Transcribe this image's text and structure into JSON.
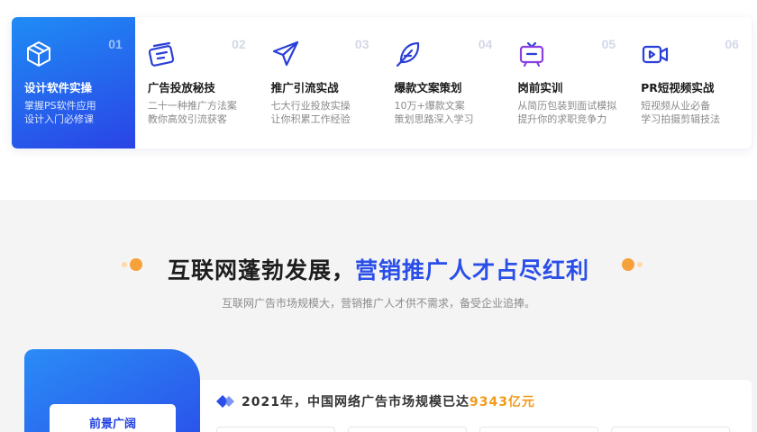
{
  "courses": [
    {
      "num": "01",
      "title": "设计软件实操",
      "desc1": "掌握PS软件应用",
      "desc2": "设计入门必修课",
      "icon": "cube-icon"
    },
    {
      "num": "02",
      "title": "广告投放秘技",
      "desc1": "二十一种推广方法案",
      "desc2": "教你高效引流获客",
      "icon": "card-icon"
    },
    {
      "num": "03",
      "title": "推广引流实战",
      "desc1": "七大行业投放实操",
      "desc2": "让你积累工作经验",
      "icon": "paper-plane-icon"
    },
    {
      "num": "04",
      "title": "爆款文案策划",
      "desc1": "10万+爆款文案",
      "desc2": "策划思路深入学习",
      "icon": "feather-icon"
    },
    {
      "num": "05",
      "title": "岗前实训",
      "desc1": "从简历包装到面试模拟",
      "desc2": "提升你的求职竞争力",
      "icon": "board-icon"
    },
    {
      "num": "06",
      "title": "PR短视频实战",
      "desc1": "短视频从业必备",
      "desc2": "学习拍摄剪辑技法",
      "icon": "video-icon"
    }
  ],
  "headline": {
    "main": "互联网蓬勃发展，",
    "accent": "营销推广人才占尽红利"
  },
  "subline": "互联网广告市场规模大，营销推广人才供不需求，备受企业追捧。",
  "side_tab": {
    "label": "前景广阔"
  },
  "stat": {
    "prefix": "2021年，中国网络广告市场规模已达",
    "value": "9343亿元"
  },
  "colors": {
    "accent_blue": "#2a4ee8",
    "accent_orange": "#f39a1b",
    "icon_blue": "#2a3fd8"
  }
}
